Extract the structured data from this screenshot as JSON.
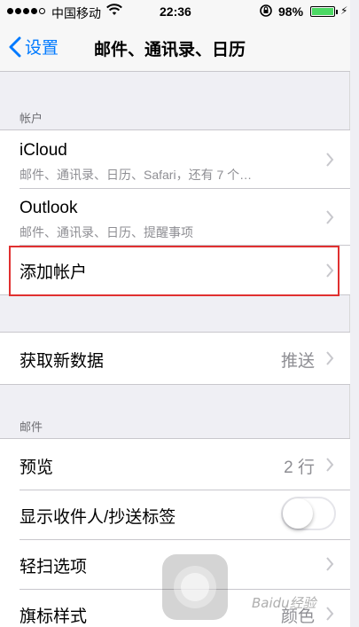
{
  "status_bar": {
    "carrier": "中国移动",
    "wifi_icon": "wifi-icon",
    "time": "22:36",
    "rotation_lock_icon": "rotation-lock-icon",
    "battery_percent": "98%",
    "battery_level": 0.98,
    "charging_icon": "bolt-icon"
  },
  "nav": {
    "back_label": "设置",
    "title": "邮件、通讯录、日历"
  },
  "accounts": {
    "header": "帐户",
    "items": [
      {
        "title": "iCloud",
        "subtitle": "邮件、通讯录、日历、Safari，还有 7 个…"
      },
      {
        "title": "Outlook",
        "subtitle": "邮件、通讯录、日历、提醒事项"
      },
      {
        "title": "添加帐户"
      }
    ]
  },
  "fetch": {
    "title": "获取新数据",
    "value": "推送"
  },
  "mail": {
    "header": "邮件",
    "preview": {
      "title": "预览",
      "value": "2 行"
    },
    "show_to_cc": {
      "title": "显示收件人/抄送标签",
      "on": false
    },
    "swipe": {
      "title": "轻扫选项"
    },
    "flag": {
      "title": "旗标样式",
      "value": "颜色"
    }
  },
  "colors": {
    "accent": "#007aff",
    "highlight_box": "#e03030",
    "background": "#efeff4"
  },
  "watermark": "Baidu经验"
}
